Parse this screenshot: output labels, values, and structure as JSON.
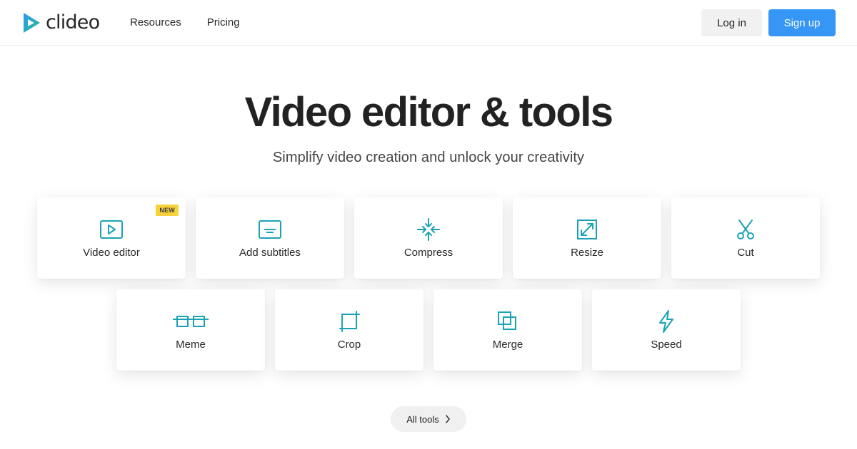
{
  "header": {
    "logo_text": "clideo",
    "nav": [
      "Resources",
      "Pricing"
    ],
    "login_label": "Log in",
    "signup_label": "Sign up"
  },
  "hero": {
    "title": "Video editor & tools",
    "subtitle": "Simplify video creation and unlock your creativity"
  },
  "tools": [
    {
      "label": "Video editor",
      "icon": "play-icon",
      "badge": "NEW"
    },
    {
      "label": "Add subtitles",
      "icon": "subtitles-icon"
    },
    {
      "label": "Compress",
      "icon": "compress-icon"
    },
    {
      "label": "Resize",
      "icon": "resize-icon"
    },
    {
      "label": "Cut",
      "icon": "scissors-icon"
    },
    {
      "label": "Meme",
      "icon": "meme-glasses-icon"
    },
    {
      "label": "Crop",
      "icon": "crop-icon"
    },
    {
      "label": "Merge",
      "icon": "merge-icon"
    },
    {
      "label": "Speed",
      "icon": "lightning-icon"
    }
  ],
  "all_tools_label": "All tools",
  "colors": {
    "icon_accent": "#1aa3b6",
    "brand_green": "#19c18d",
    "brand_blue": "#3596f5",
    "badge_yellow": "#f7d23a"
  }
}
